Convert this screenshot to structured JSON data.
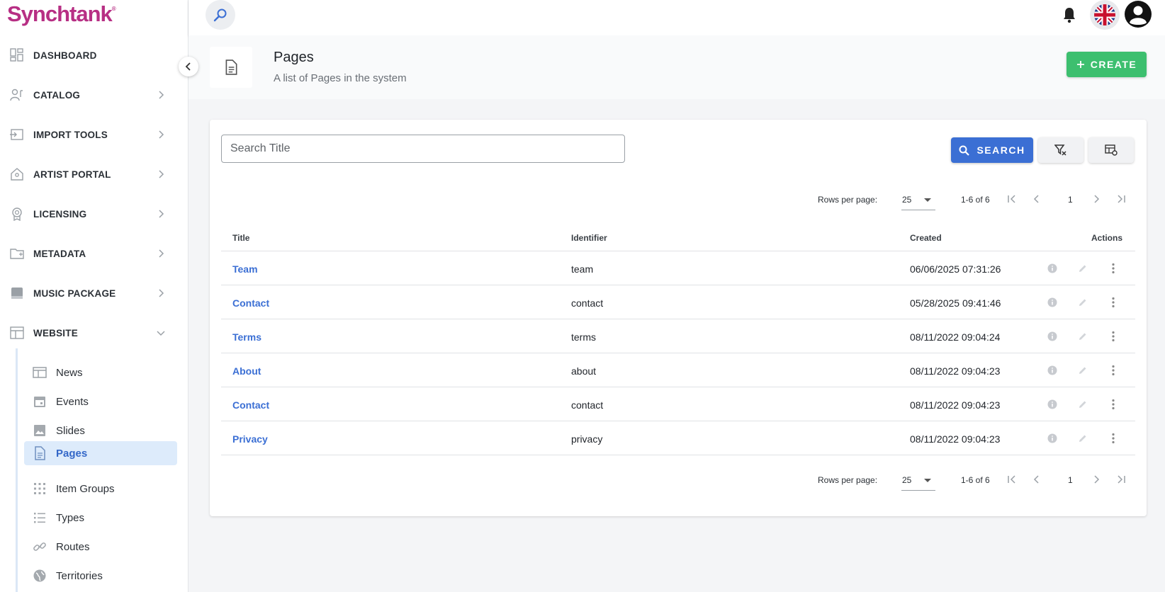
{
  "brand": {
    "name": "Synchtank",
    "mark": "®"
  },
  "sidebar": {
    "items": [
      {
        "label": "DASHBOARD"
      },
      {
        "label": "CATALOG"
      },
      {
        "label": "IMPORT TOOLS"
      },
      {
        "label": "ARTIST PORTAL"
      },
      {
        "label": "LICENSING"
      },
      {
        "label": "METADATA"
      },
      {
        "label": "MUSIC PACKAGE"
      },
      {
        "label": "WEBSITE"
      }
    ],
    "website_sub": [
      {
        "label": "News"
      },
      {
        "label": "Events"
      },
      {
        "label": "Slides"
      },
      {
        "label": "Pages"
      },
      {
        "label": "Item Groups"
      },
      {
        "label": "Types"
      },
      {
        "label": "Routes"
      },
      {
        "label": "Territories"
      }
    ],
    "active_sub": "Pages"
  },
  "header": {
    "title": "Pages",
    "subtitle": "A list of Pages in the system",
    "create_label": "CREATE"
  },
  "search": {
    "placeholder": "Search Title",
    "value": "",
    "button_label": "SEARCH"
  },
  "pagination": {
    "rows_per_page_label": "Rows per page:",
    "rows_per_page": "25",
    "range": "1-6 of 6",
    "page": "1"
  },
  "table": {
    "columns": {
      "title": "Title",
      "identifier": "Identifier",
      "created": "Created",
      "actions": "Actions"
    },
    "rows": [
      {
        "title": "Team",
        "identifier": "team",
        "created": "06/06/2025 07:31:26"
      },
      {
        "title": "Contact",
        "identifier": "contact",
        "created": "05/28/2025 09:41:46"
      },
      {
        "title": "Terms",
        "identifier": "terms",
        "created": "08/11/2022 09:04:24"
      },
      {
        "title": "About",
        "identifier": "about",
        "created": "08/11/2022 09:04:23"
      },
      {
        "title": "Contact",
        "identifier": "contact",
        "created": "08/11/2022 09:04:23"
      },
      {
        "title": "Privacy",
        "identifier": "privacy",
        "created": "08/11/2022 09:04:23"
      }
    ]
  },
  "colors": {
    "brand": "#b72f84",
    "primary": "#3b6fd4",
    "create": "#3dbf6f",
    "active_bg": "#ddebfb"
  }
}
